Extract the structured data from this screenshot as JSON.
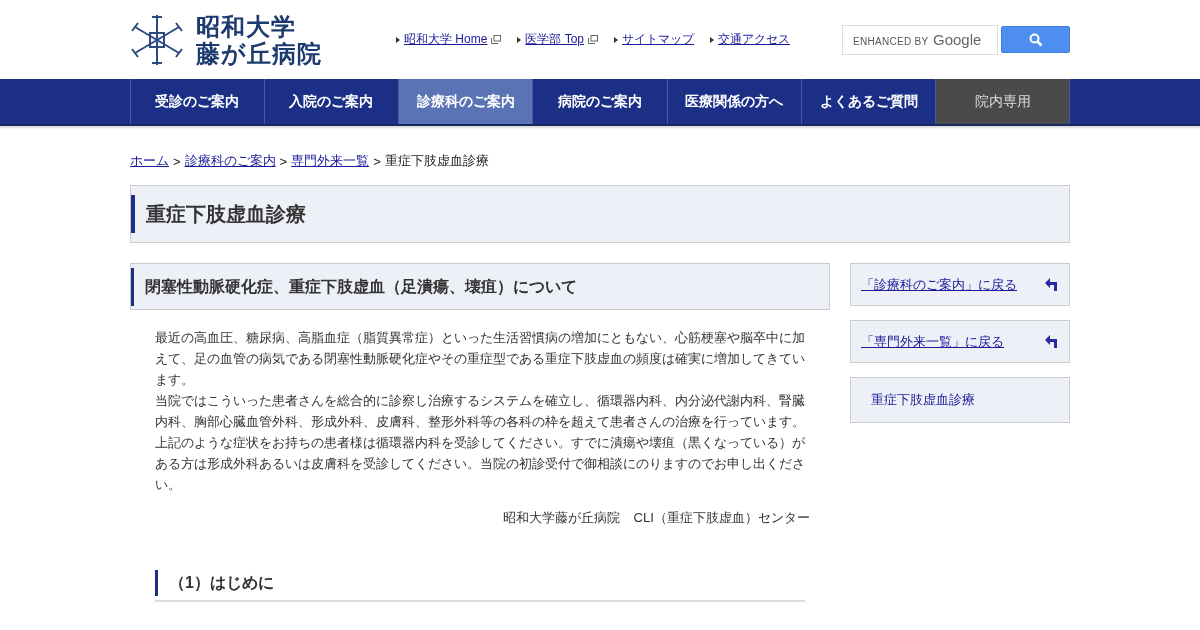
{
  "header": {
    "logo": {
      "line_1": "昭和大学",
      "line_2": "藤が丘病院"
    },
    "links": [
      {
        "label": "昭和大学 Home",
        "external": true
      },
      {
        "label": "医学部 Top",
        "external": true
      },
      {
        "label": "サイトマップ",
        "external": false
      },
      {
        "label": "交通アクセス",
        "external": false
      }
    ],
    "search": {
      "enhanced_by": "ENHANCED BY",
      "brand": "Google"
    }
  },
  "nav": [
    {
      "label": "受診のご案内",
      "selected": false,
      "kind": "public"
    },
    {
      "label": "入院のご案内",
      "selected": false,
      "kind": "public"
    },
    {
      "label": "診療科のご案内",
      "selected": true,
      "kind": "public"
    },
    {
      "label": "病院のご案内",
      "selected": false,
      "kind": "public"
    },
    {
      "label": "医療関係の方へ",
      "selected": false,
      "kind": "public"
    },
    {
      "label": "よくあるご質問",
      "selected": false,
      "kind": "public"
    },
    {
      "label": "院内専用",
      "selected": false,
      "kind": "internal"
    }
  ],
  "breadcrumb": {
    "separator": ">",
    "items": [
      {
        "label": "ホーム",
        "link": true
      },
      {
        "label": "診療科のご案内",
        "link": true
      },
      {
        "label": "専門外来一覧",
        "link": true
      },
      {
        "label": "重症下肢虚血診療",
        "link": false
      }
    ]
  },
  "page_title": "重症下肢虚血診療",
  "main": {
    "heading": "閉塞性動脈硬化症、重症下肢虚血（足潰瘍、壊疽）について",
    "paragraphs": [
      "最近の高血圧、糖尿病、高脂血症（脂質異常症）といった生活習慣病の増加にともない、心筋梗塞や脳卒中に加えて、足の血管の病気である閉塞性動脈硬化症やその重症型である重症下肢虚血の頻度は確実に増加してきています。",
      "当院ではこういった患者さんを総合的に診察し治療するシステムを確立し、循環器内科、内分泌代謝内科、腎臓内科、胸部心臓血管外科、形成外科、皮膚科、整形外科等の各科の枠を超えて患者さんの治療を行っています。",
      "上記のような症状をお持ちの患者様は循環器内科を受診してください。すでに潰瘍や壊疽（黒くなっている）がある方は形成外科あるいは皮膚科を受診してください。当院の初診受付で御相談にのりますのでお申し出ください。"
    ],
    "signature": "昭和大学藤が丘病院　CLI（重症下肢虚血）センター",
    "subheading": "（1）はじめに"
  },
  "sidebar": [
    {
      "label": "「診療科のご案内」に戻る",
      "kind": "back"
    },
    {
      "label": "「専門外来一覧」に戻る",
      "kind": "back"
    },
    {
      "label": "重症下肢虚血診療",
      "kind": "current"
    }
  ]
}
